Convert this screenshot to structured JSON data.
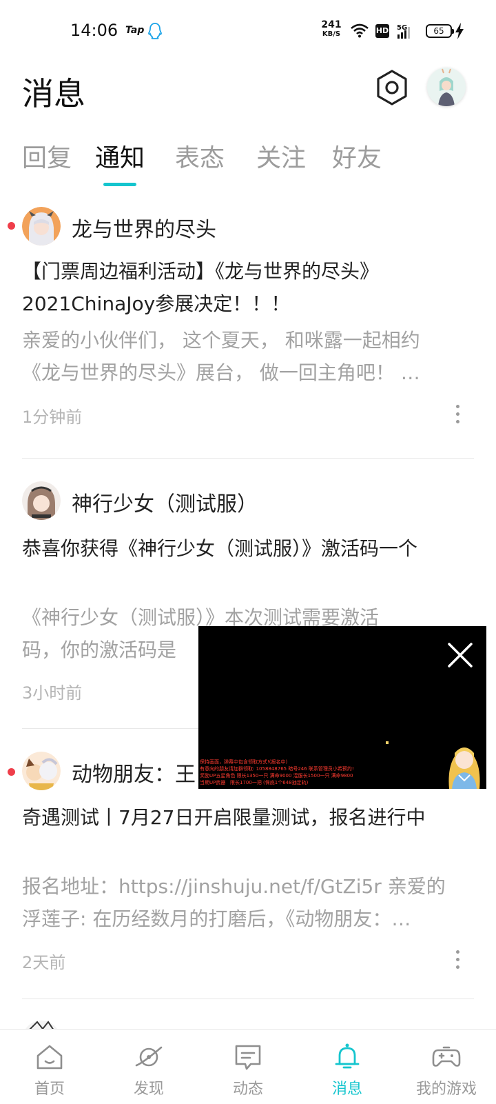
{
  "status_bar": {
    "time": "14:06",
    "app_icon": "Tap",
    "net_speed": "241",
    "net_unit": "KB/S",
    "hd": "HD",
    "network": "5G",
    "battery": "65"
  },
  "header": {
    "title": "消息"
  },
  "tabs": [
    {
      "label": "回复",
      "active": false
    },
    {
      "label": "通知",
      "active": true
    },
    {
      "label": "表态",
      "active": false
    },
    {
      "label": "关注",
      "active": false
    },
    {
      "label": "好友",
      "active": false
    }
  ],
  "notifications": [
    {
      "source": "龙与世界的尽头",
      "unread": true,
      "title": "【门票周边福利活动】《龙与世界的尽头》2021ChinaJoy参展决定！！！",
      "body_line1": "亲爱的小伙伴们， 这个夏天， 和咪露一起相约",
      "body_line2": "《龙与世界的尽头》展台， 做一回主角吧！ …",
      "time": "1分钟前"
    },
    {
      "source": "神行少女（测试服）",
      "unread": false,
      "title": "恭喜你获得《神行少女（测试服）》激活码一个",
      "body_line1": "《神行少女（测试服）》本次测试需要激活",
      "body_line2": "码，你的激活码是",
      "time": "3小时前"
    },
    {
      "source": "动物朋友：王",
      "unread": true,
      "title": "奇遇测试丨7月27日开启限量测试，报名进行中",
      "body_line1": "报名地址：https://jinshuju.net/f/GtZi5r 亲爱的",
      "body_line2": "浮莲子: 在历经数月的打磨后，《动物朋友：…",
      "time": "2天前"
    }
  ],
  "video_overlay": {
    "subtitle_lines": [
      "保持画面，弹幕中包含领取方式!(报名中)",
      "有意向的朋友请加群领取: 1058848765 暗号246 联系管理员小希预约!",
      "奖励UP五星角色 限长1350一只 满命9000 混服长1500一只 满命9800",
      "当期UP武器   限长1700一把 (保底1个648抽定轨)"
    ]
  },
  "bottom_nav": [
    {
      "label": "首页",
      "icon": "home-icon",
      "active": false
    },
    {
      "label": "发现",
      "icon": "planet-icon",
      "active": false
    },
    {
      "label": "动态",
      "icon": "chat-icon",
      "active": false
    },
    {
      "label": "消息",
      "icon": "bell-icon",
      "active": true
    },
    {
      "label": "我的游戏",
      "icon": "gamepad-icon",
      "active": false
    }
  ],
  "colors": {
    "accent": "#15c5ce",
    "unread_dot": "#ef3e4a",
    "muted_text": "#a2a2a2"
  }
}
